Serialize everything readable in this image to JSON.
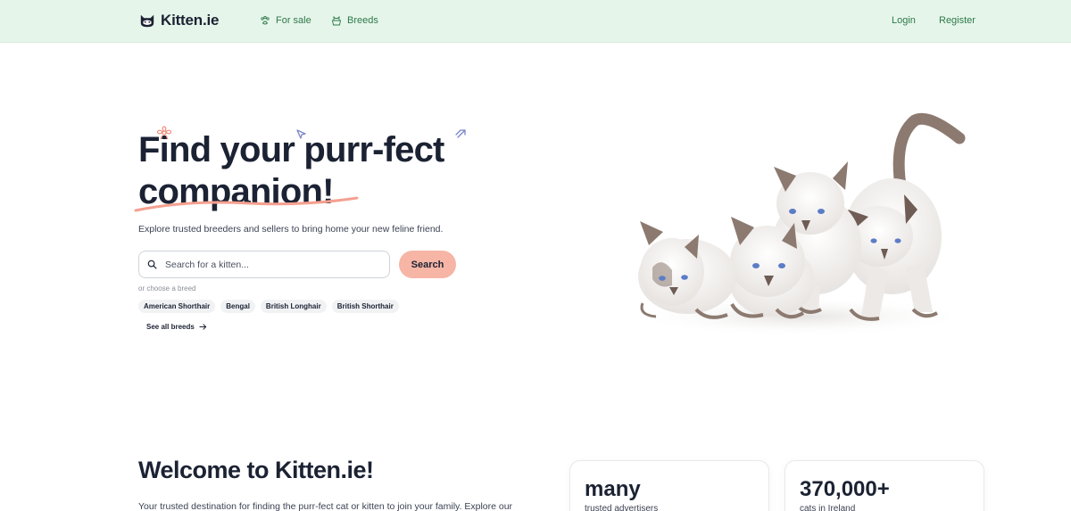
{
  "nav": {
    "brand": "Kitten.ie",
    "for_sale": "For sale",
    "breeds": "Breeds",
    "login": "Login",
    "register": "Register"
  },
  "hero": {
    "title_line1": "Find your purr-fect",
    "title_line2": "companion!",
    "subtitle": "Explore trusted breeders and sellers to bring home your new feline friend.",
    "search_placeholder": "Search for a kitten...",
    "search_button": "Search",
    "choose_label": "or choose a breed",
    "breeds": [
      "American Shorthair",
      "Bengal",
      "British Longhair",
      "British Shorthair"
    ],
    "see_all": "See all breeds"
  },
  "welcome": {
    "title": "Welcome to Kitten.ie!",
    "text": "Your trusted destination for finding the purr-fect cat or kitten to join your family. Explore our"
  },
  "stats": [
    {
      "value": "many",
      "label": "trusted advertisers"
    },
    {
      "value": "370,000+",
      "label": "cats in Ireland"
    }
  ],
  "colors": {
    "nav_bg": "#e6f5ea",
    "nav_link": "#2c7a4a",
    "accent": "#f7b5a5",
    "text_dark": "#1b2233"
  },
  "icons": {
    "logo": "cat-face-icon",
    "for_sale": "paw-icon",
    "breeds": "cat-basket-icon",
    "search": "search-icon",
    "see_all": "arrow-right-icon"
  }
}
